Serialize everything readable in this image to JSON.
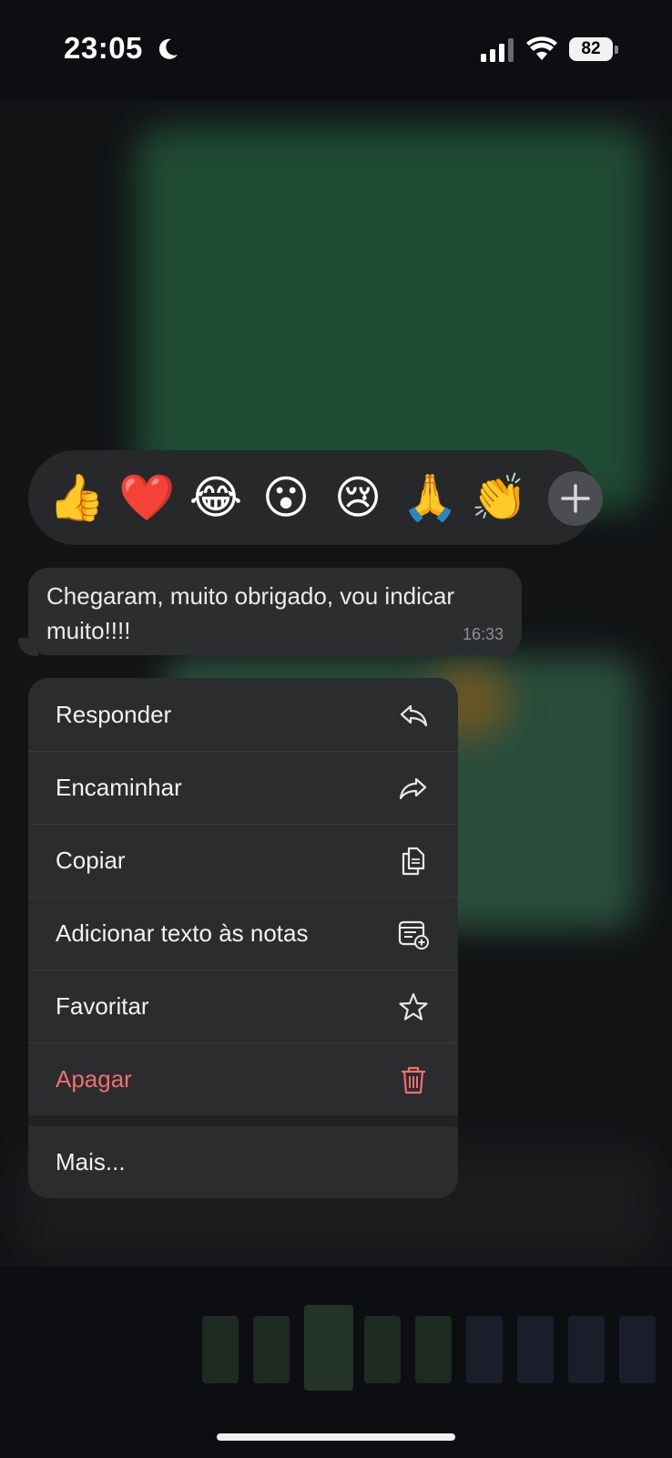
{
  "status_bar": {
    "time": "23:05",
    "battery": "82"
  },
  "reactions": {
    "emojis": [
      "👍",
      "❤️",
      "😂",
      "😮",
      "😢",
      "🙏",
      "👏"
    ],
    "plus_icon": "plus-icon"
  },
  "message": {
    "text": "Chegaram, muito obrigado, vou indicar muito!!!!",
    "time": "16:33"
  },
  "menu": {
    "items": [
      {
        "label": "Responder",
        "icon": "reply-icon"
      },
      {
        "label": "Encaminhar",
        "icon": "forward-icon"
      },
      {
        "label": "Copiar",
        "icon": "copy-icon"
      },
      {
        "label": "Adicionar texto às notas",
        "icon": "add-note-icon"
      },
      {
        "label": "Favoritar",
        "icon": "star-icon"
      },
      {
        "label": "Apagar",
        "icon": "trash-icon"
      }
    ],
    "more": "Mais..."
  },
  "colors": {
    "danger": "#ef6f6f",
    "menu_bg": "#2a2c2e",
    "bubble_bg": "#2b2d2f"
  }
}
